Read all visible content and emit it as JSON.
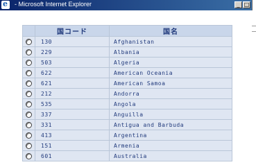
{
  "window": {
    "title": "- Microsoft Internet Explorer",
    "minimize_label": "_",
    "maximize_label": "□"
  },
  "table": {
    "headers": {
      "select": "",
      "code": "国コード",
      "name": "国名"
    },
    "rows": [
      {
        "code": "130",
        "name": "Afghanistan"
      },
      {
        "code": "229",
        "name": "Albania"
      },
      {
        "code": "503",
        "name": "Algeria"
      },
      {
        "code": "622",
        "name": "American Oceania"
      },
      {
        "code": "621",
        "name": "American Samoa"
      },
      {
        "code": "212",
        "name": "Andorra"
      },
      {
        "code": "535",
        "name": "Angola"
      },
      {
        "code": "337",
        "name": "Anguilla"
      },
      {
        "code": "331",
        "name": "Antigua and Barbuda"
      },
      {
        "code": "413",
        "name": "Argentina"
      },
      {
        "code": "151",
        "name": "Armenia"
      },
      {
        "code": "601",
        "name": "Australia"
      }
    ]
  }
}
